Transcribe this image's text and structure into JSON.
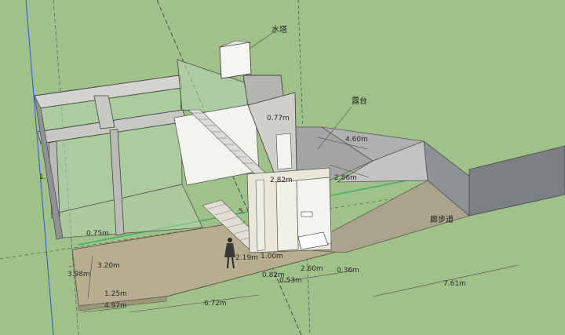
{
  "labels": {
    "water_tower": "水塔",
    "terrace": "露台",
    "corridor": "廊步道"
  },
  "dimensions": {
    "d_077": "0.77m",
    "d_460": "4.60m",
    "d_286": "2.86m",
    "d_1x": "1.",
    "d_075": "0.75m",
    "d_320": "3.20m",
    "d_398": "3.98m",
    "d_125": "1.25m",
    "d_497": "4.97m",
    "d_672": "6.72m",
    "d_219": "2.19m",
    "d_100": "1.00m",
    "d_082": "0.82m",
    "d_053": "0.53m",
    "d_260": "2.60m",
    "d_036": "0.36m",
    "d_761": "7.61m",
    "d_5": "5.",
    "d_282": "2.82m"
  },
  "colors": {
    "background": "#a1c18a",
    "wall_light": "#f4f4ee",
    "wall_mid": "#c9cbc4",
    "wall_dark": "#8f9395",
    "glass": "#b7d3b0",
    "floor": "#b6ae8e",
    "terrace": "#a4a4a6",
    "dark_block": "#7b8082",
    "axis_red": "#c0392b",
    "axis_green": "#27ae60",
    "axis_blue": "#2f56d8"
  }
}
